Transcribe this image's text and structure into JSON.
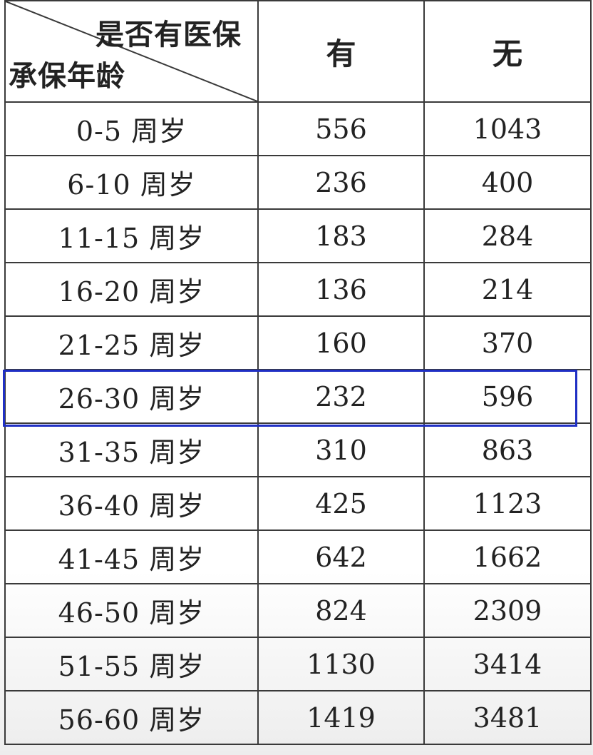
{
  "header": {
    "corner_top": "是否有医保",
    "corner_bottom": "承保年龄",
    "col_yes": "有",
    "col_no": "无"
  },
  "rows": [
    {
      "age": "0-5 周岁",
      "yes": "556",
      "no": "1043"
    },
    {
      "age": "6-10 周岁",
      "yes": "236",
      "no": "400"
    },
    {
      "age": "11-15 周岁",
      "yes": "183",
      "no": "284"
    },
    {
      "age": "16-20 周岁",
      "yes": "136",
      "no": "214"
    },
    {
      "age": "21-25 周岁",
      "yes": "160",
      "no": "370"
    },
    {
      "age": "26-30 周岁",
      "yes": "232",
      "no": "596"
    },
    {
      "age": "31-35 周岁",
      "yes": "310",
      "no": "863"
    },
    {
      "age": "36-40 周岁",
      "yes": "425",
      "no": "1123"
    },
    {
      "age": "41-45 周岁",
      "yes": "642",
      "no": "1662"
    },
    {
      "age": "46-50 周岁",
      "yes": "824",
      "no": "2309"
    },
    {
      "age": "51-55 周岁",
      "yes": "1130",
      "no": "3414"
    },
    {
      "age": "56-60 周岁",
      "yes": "1419",
      "no": "3481"
    }
  ],
  "highlight": {
    "row_index": 5,
    "color": "#1f2fc4"
  }
}
